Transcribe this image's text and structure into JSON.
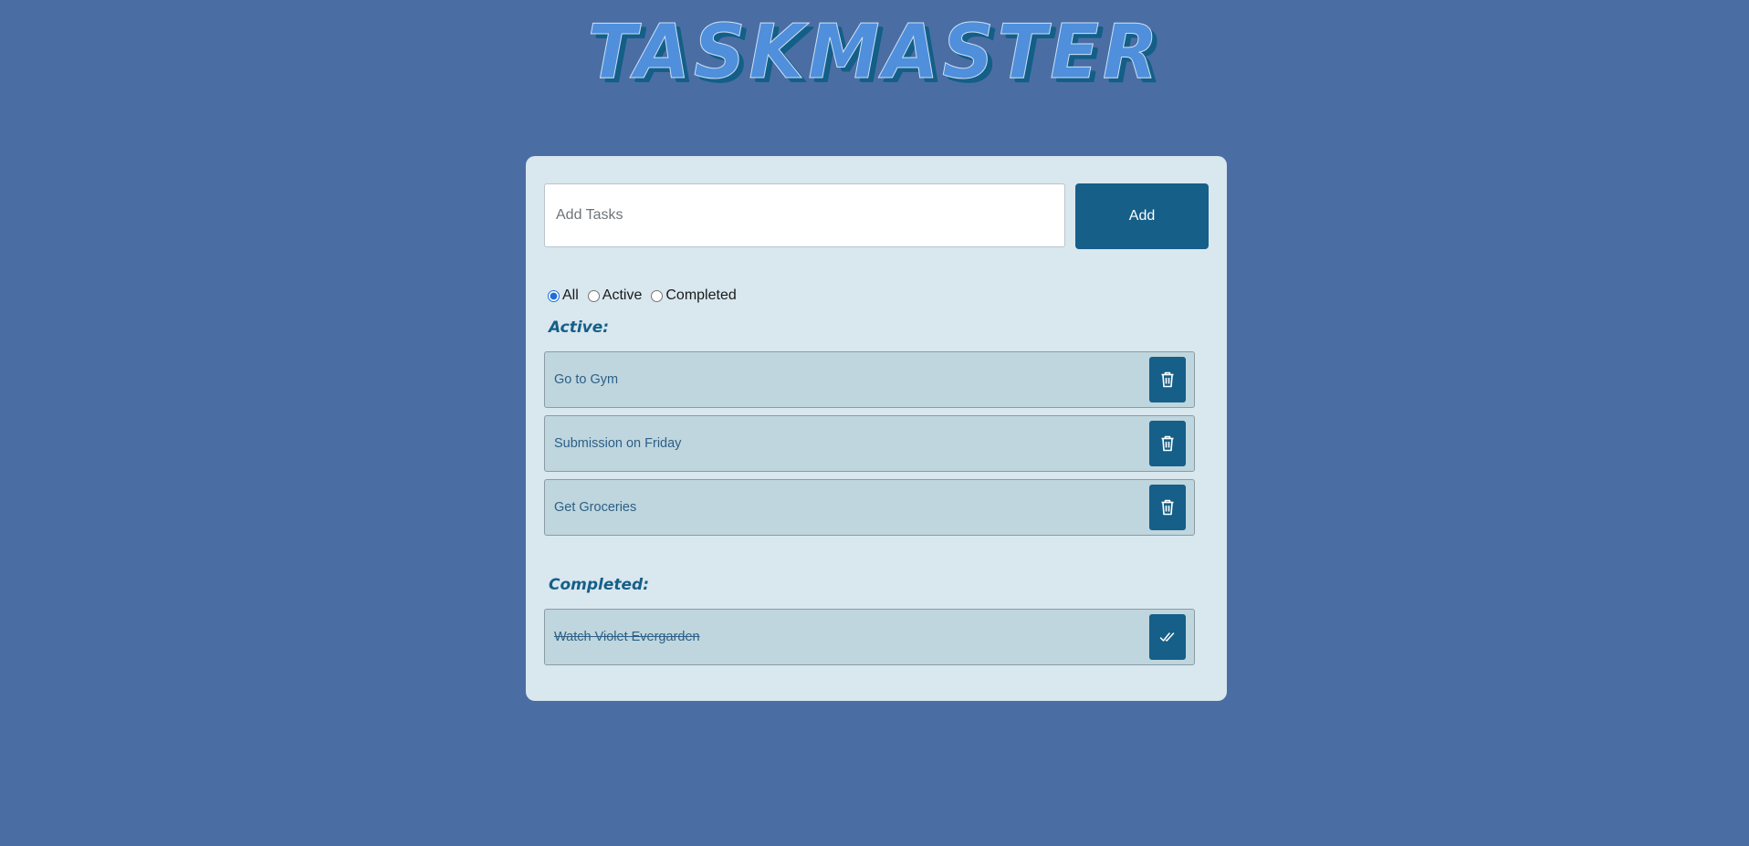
{
  "app": {
    "title": "TASKMASTER"
  },
  "input": {
    "placeholder": "Add Tasks",
    "value": ""
  },
  "add_button": {
    "label": "Add"
  },
  "filters": {
    "selected": "All",
    "options": [
      {
        "label": "All",
        "checked": true
      },
      {
        "label": "Active",
        "checked": false
      },
      {
        "label": "Completed",
        "checked": false
      }
    ]
  },
  "active": {
    "heading": "Active:",
    "tasks": [
      {
        "text": "Go to Gym",
        "action_icon": "trash-icon"
      },
      {
        "text": "Submission on Friday",
        "action_icon": "trash-icon"
      },
      {
        "text": "Get Groceries",
        "action_icon": "trash-icon"
      }
    ]
  },
  "completed": {
    "heading": "Completed:",
    "tasks": [
      {
        "text": "Watch Violet Evergarden",
        "action_icon": "double-check-icon"
      }
    ]
  },
  "colors": {
    "page_background": "#4a6ea3",
    "card_background": "#d9e7ee",
    "accent": "#155f88",
    "task_background": "#bfd6de",
    "title_fill": "#4f8fdc"
  }
}
